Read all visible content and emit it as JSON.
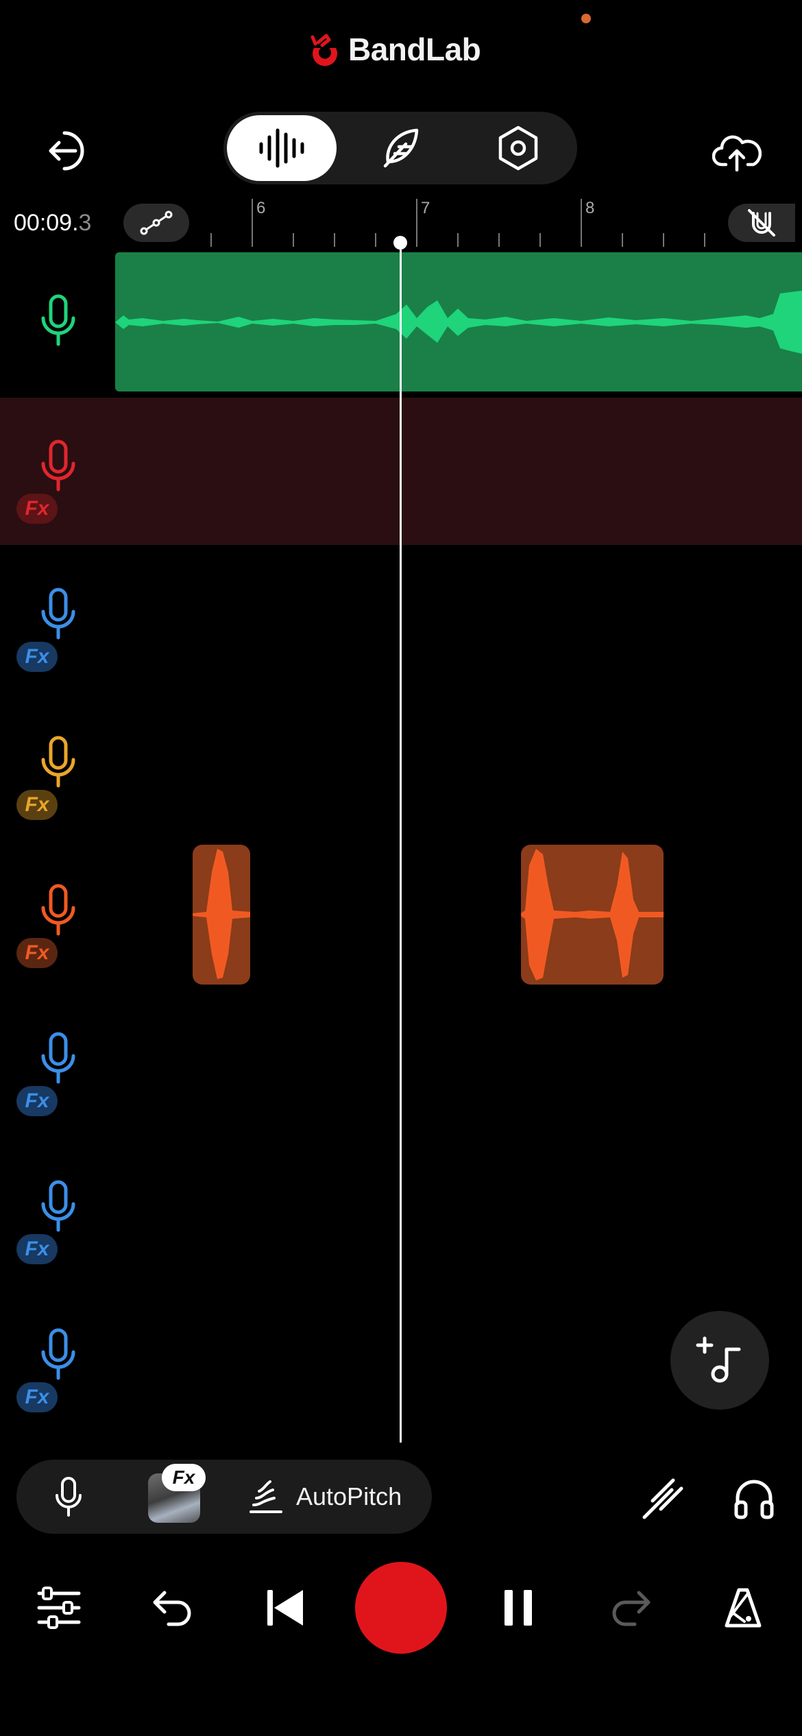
{
  "app": {
    "brand": "BandLab"
  },
  "colors": {
    "brand_red": "#e0151c",
    "track_green": "#1fd47a",
    "track_red": "#e0262e",
    "track_blue": "#3b8fe8",
    "track_yellow": "#e9a62a",
    "track_orange": "#f05a22"
  },
  "timeline": {
    "time_main": "00:09.",
    "time_frac": "3",
    "ruler_labels": [
      "6",
      "7",
      "8"
    ]
  },
  "tracks": [
    {
      "color": "green",
      "icon": "mic-icon",
      "fx": ""
    },
    {
      "color": "red",
      "icon": "mic-icon",
      "fx": "Fx"
    },
    {
      "color": "blue",
      "icon": "mic-icon",
      "fx": "Fx"
    },
    {
      "color": "yellow",
      "icon": "mic-icon",
      "fx": "Fx"
    },
    {
      "color": "orange",
      "icon": "mic-icon",
      "fx": "Fx"
    },
    {
      "color": "blue",
      "icon": "mic-icon",
      "fx": "Fx"
    },
    {
      "color": "blue",
      "icon": "mic-icon",
      "fx": "Fx"
    },
    {
      "color": "blue",
      "icon": "mic-icon",
      "fx": "Fx"
    }
  ],
  "toolbar": {
    "fx_label": "Fx",
    "autopitch_label": "AutoPitch"
  }
}
